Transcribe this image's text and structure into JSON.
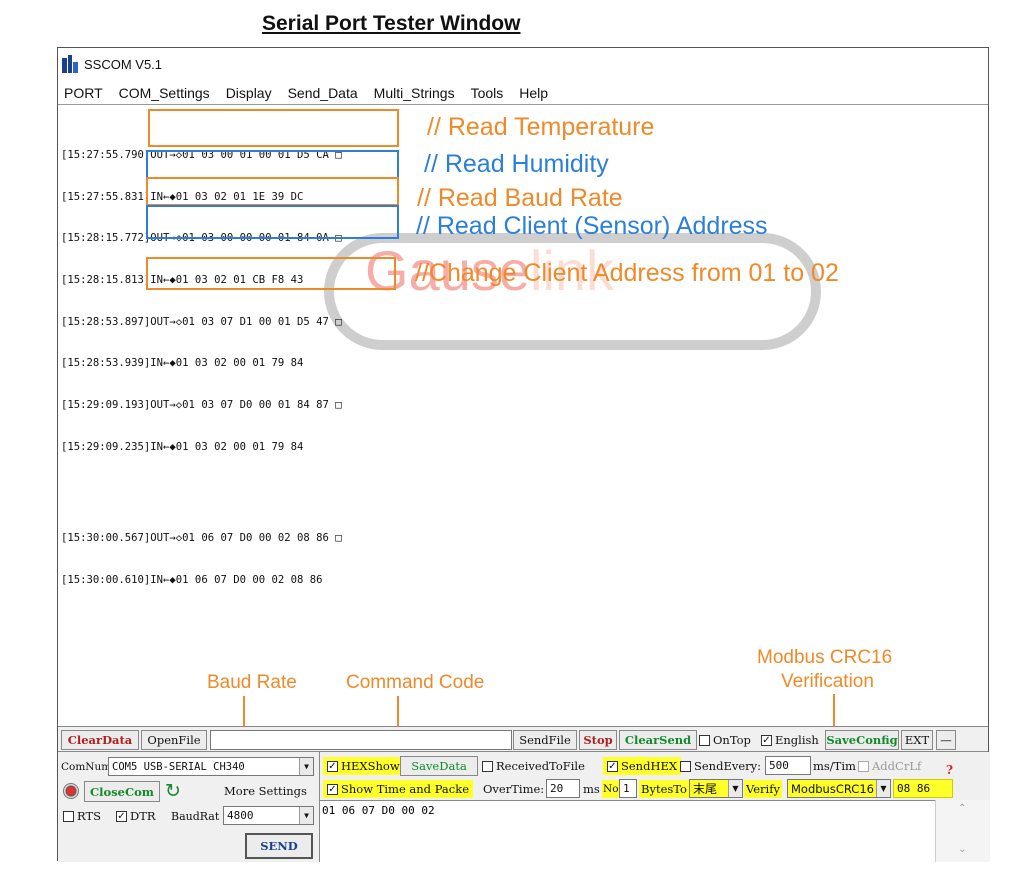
{
  "heading": "Serial Port Tester Window",
  "window": {
    "title": "SSCOM V5.1",
    "menu": [
      "PORT",
      "COM_Settings",
      "Display",
      "Send_Data",
      "Multi_Strings",
      "Tools",
      "Help"
    ]
  },
  "log": [
    "[15:27:55.790]OUT→◇01 03 00 01 00 01 D5 CA □",
    "[15:27:55.831]IN←◆01 03 02 01 1E 39 DC",
    "[15:28:15.772]OUT→◇01 03 00 00 00 01 84 0A □",
    "[15:28:15.813]IN←◆01 03 02 01 CB F8 43",
    "[15:28:53.897]OUT→◇01 03 07 D1 00 01 D5 47 □",
    "[15:28:53.939]IN←◆01 03 02 00 01 79 84",
    "[15:29:09.193]OUT→◇01 03 07 D0 00 01 84 87 □",
    "[15:29:09.235]IN←◆01 03 02 00 01 79 84",
    "[15:30:00.567]OUT→◇01 06 07 D0 00 02 08 86 □",
    "[15:30:00.610]IN←◆01 06 07 D0 00 02 08 86"
  ],
  "annotations": {
    "temperature": "// Read Temperature",
    "humidity": "// Read Humidity",
    "baud": "// Read Baud Rate",
    "address": "// Read Client (Sensor) Address",
    "change": "//Change Client Address from 01 to 02"
  },
  "watermark": {
    "part1": "Gause",
    "part2": "link"
  },
  "callouts": {
    "baud_rate": "Baud Rate",
    "command_code": "Command Code",
    "crc_line1": "Modbus CRC16",
    "crc_line2": "Verification"
  },
  "toolbar": {
    "clear_data": "ClearData",
    "open_file": "OpenFile",
    "send_file": "SendFile",
    "stop": "Stop",
    "clear_send": "ClearSend",
    "on_top": "OnTop",
    "english": "English",
    "save_config": "SaveConfig",
    "ext": "EXT",
    "minus": "—"
  },
  "controls": {
    "comnum_label": "ComNum",
    "com_port": "COM5 USB-SERIAL CH340",
    "close_com": "CloseCom",
    "more_settings": "More Settings",
    "rts": "RTS",
    "dtr": "DTR",
    "baudrate_label": "BaudRat",
    "baudrate": "4800",
    "send": "SEND",
    "hex_show": "HEXShow",
    "save_data": "SaveData",
    "received_to_file": "ReceivedToFile",
    "send_hex": "SendHEX",
    "send_every": "SendEvery:",
    "interval": "500",
    "interval_unit": "ms/Tim",
    "add_crlf": "AddCrLf",
    "show_time": "Show Time and Packe",
    "overtime": "OverTime:",
    "overtime_value": "20",
    "ms": "ms",
    "no": "No",
    "no_value": "1",
    "bytes_to": "BytesTo",
    "bytes_to_value": "末尾",
    "verify": "Verify",
    "verify_value": "ModbusCRC16",
    "crc_value": "08 86",
    "send_text": "01 06 07 D0 00 02"
  }
}
